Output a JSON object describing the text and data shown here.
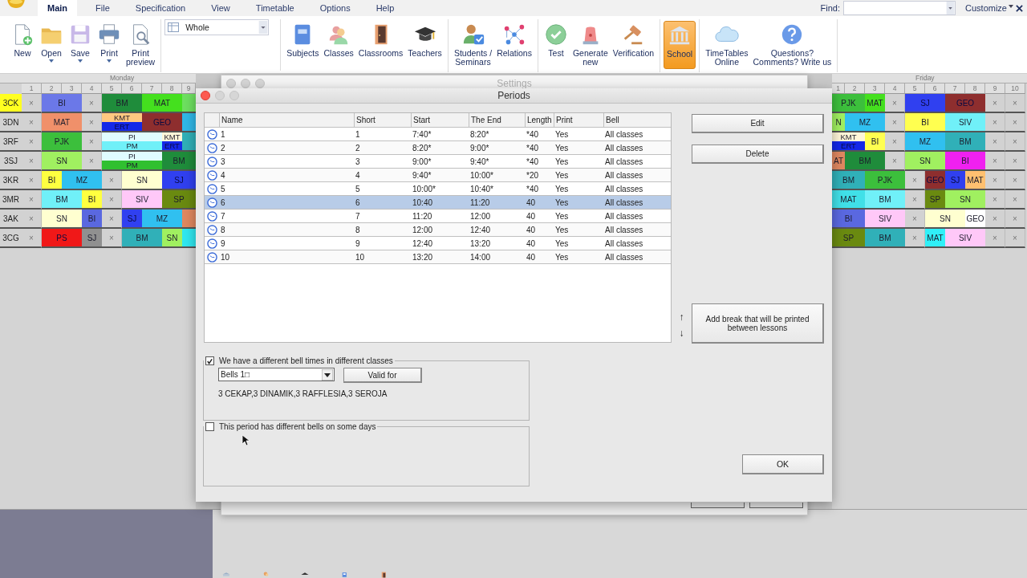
{
  "menu": {
    "tabs": [
      {
        "label": "Main",
        "selected": true
      },
      {
        "label": "File",
        "selected": false
      },
      {
        "label": "Specification",
        "selected": false
      },
      {
        "label": "View",
        "selected": false
      },
      {
        "label": "Timetable",
        "selected": false
      },
      {
        "label": "Options",
        "selected": false
      },
      {
        "label": "Help",
        "selected": false
      }
    ],
    "find_label": "Find:",
    "customize": "Customize"
  },
  "ribbon": {
    "groups": [
      {
        "kind": "buttons",
        "buttons": [
          {
            "label": "New",
            "has_menu": false,
            "selected": false
          },
          {
            "label": "Open",
            "has_menu": true,
            "selected": false
          },
          {
            "label": "Save",
            "has_menu": true,
            "selected": false
          },
          {
            "label": "Print",
            "has_menu": true,
            "selected": false
          },
          {
            "label": "Print\npreview",
            "has_menu": false,
            "selected": false
          }
        ]
      },
      {
        "kind": "dropdown",
        "value": "Whole"
      },
      {
        "kind": "buttons",
        "buttons": [
          {
            "label": "Subjects",
            "has_menu": false,
            "selected": false
          },
          {
            "label": "Classes",
            "has_menu": false,
            "selected": false
          },
          {
            "label": "Classrooms",
            "has_menu": false,
            "selected": false
          },
          {
            "label": "Teachers",
            "has_menu": false,
            "selected": false
          }
        ]
      },
      {
        "kind": "buttons",
        "buttons": [
          {
            "label": "Students /\nSeminars",
            "has_menu": false,
            "selected": false
          },
          {
            "label": "Relations",
            "has_menu": false,
            "selected": false
          }
        ]
      },
      {
        "kind": "buttons",
        "buttons": [
          {
            "label": "Test",
            "has_menu": false,
            "selected": false
          },
          {
            "label": "Generate\nnew",
            "has_menu": false,
            "selected": false
          },
          {
            "label": "Verification",
            "has_menu": false,
            "selected": false
          }
        ]
      },
      {
        "kind": "buttons",
        "buttons": [
          {
            "label": "School",
            "has_menu": false,
            "selected": true
          }
        ]
      },
      {
        "kind": "buttons",
        "buttons": [
          {
            "label": "TimeTables\nOnline",
            "has_menu": false,
            "selected": false
          },
          {
            "label": "Questions?\nComments? Write us",
            "has_menu": false,
            "selected": false
          }
        ]
      }
    ]
  },
  "timetable": {
    "left": {
      "day": "Monday",
      "periods": [
        "1",
        "2",
        "3",
        "4",
        "5",
        "6",
        "7",
        "8",
        "9"
      ],
      "rows": [
        {
          "class": "3CK",
          "selected": true,
          "cells": [
            {
              "kind": "free",
              "text": "×"
            },
            {
              "kind": "lesson",
              "text": "BI",
              "color": "#6b78e8",
              "colspan": 2
            },
            {
              "kind": "free",
              "text": "×"
            },
            {
              "kind": "lesson",
              "text": "BM",
              "color": "#1f8c3b",
              "colspan": 2
            },
            {
              "kind": "lesson",
              "text": "MAT",
              "color": "#44e01e",
              "colspan": 2
            },
            {
              "kind": "cut",
              "color": "#6ee060"
            }
          ]
        },
        {
          "class": "3DN",
          "selected": false,
          "cells": [
            {
              "kind": "free",
              "text": "×"
            },
            {
              "kind": "lesson",
              "text": "MAT",
              "color": "#f0906a",
              "colspan": 2
            },
            {
              "kind": "free",
              "text": "×"
            },
            {
              "kind": "split",
              "colspan": 2,
              "parts": [
                {
                  "text": "KMT",
                  "color": "#ffc880"
                },
                {
                  "text": "ERT",
                  "color": "#1428e8"
                }
              ]
            },
            {
              "kind": "lesson",
              "text": "GEO",
              "color": "#8e2e2e",
              "colspan": 2
            },
            {
              "kind": "cut",
              "color": "#30b8e8"
            }
          ]
        },
        {
          "class": "3RF",
          "selected": false,
          "cells": [
            {
              "kind": "free",
              "text": "×"
            },
            {
              "kind": "lesson",
              "text": "PJK",
              "color": "#3cbf3c",
              "colspan": 2
            },
            {
              "kind": "free",
              "text": "×"
            },
            {
              "kind": "split",
              "colspan": 3,
              "parts": [
                {
                  "text": "PI",
                  "color": "#e0fcff"
                },
                {
                  "text": "PM",
                  "color": "#70f0f8"
                }
              ]
            },
            {
              "kind": "split",
              "parts": [
                {
                  "text": "KMT",
                  "color": "#fff6d8"
                },
                {
                  "text": "ERT",
                  "color": "#1428e8"
                }
              ]
            },
            {
              "kind": "cut",
              "color": "#30b0b8"
            }
          ]
        },
        {
          "class": "3SJ",
          "selected": false,
          "cells": [
            {
              "kind": "free",
              "text": "×"
            },
            {
              "kind": "lesson",
              "text": "SN",
              "color": "#a0f060",
              "colspan": 2
            },
            {
              "kind": "free",
              "text": "×"
            },
            {
              "kind": "split",
              "colspan": 3,
              "parts": [
                {
                  "text": "PI",
                  "color": "#e0fcff"
                },
                {
                  "text": "PM",
                  "color": "#30c030"
                }
              ]
            },
            {
              "kind": "lesson",
              "text": "BM",
              "color": "#1f8c3b",
              "colspan": 2
            }
          ]
        },
        {
          "class": "3KR",
          "selected": false,
          "cells": [
            {
              "kind": "free",
              "text": "×"
            },
            {
              "kind": "lesson",
              "text": "BI",
              "color": "#ffff40"
            },
            {
              "kind": "lesson",
              "text": "MZ",
              "color": "#30c0f0",
              "colspan": 2
            },
            {
              "kind": "free",
              "text": "×"
            },
            {
              "kind": "lesson",
              "text": "SN",
              "color": "#ffffd0",
              "colspan": 2
            },
            {
              "kind": "lesson",
              "text": "SJ",
              "color": "#3040f0",
              "colspan": 2
            }
          ]
        },
        {
          "class": "3MR",
          "selected": false,
          "cells": [
            {
              "kind": "free",
              "text": "×"
            },
            {
              "kind": "lesson",
              "text": "BM",
              "color": "#70f0f8",
              "colspan": 2
            },
            {
              "kind": "lesson",
              "text": "BI",
              "color": "#ffff40"
            },
            {
              "kind": "free",
              "text": "×"
            },
            {
              "kind": "lesson",
              "text": "SIV",
              "color": "#ffc8f8",
              "colspan": 2
            },
            {
              "kind": "lesson",
              "text": "SP",
              "color": "#6a8a10",
              "colspan": 2
            }
          ]
        },
        {
          "class": "3AK",
          "selected": false,
          "cells": [
            {
              "kind": "free",
              "text": "×"
            },
            {
              "kind": "lesson",
              "text": "SN",
              "color": "#ffffd0",
              "colspan": 2
            },
            {
              "kind": "lesson",
              "text": "BI",
              "color": "#5a68e0"
            },
            {
              "kind": "free",
              "text": "×"
            },
            {
              "kind": "lesson",
              "text": "SJ",
              "color": "#3040f0"
            },
            {
              "kind": "lesson",
              "text": "MZ",
              "color": "#30c0f0",
              "colspan": 2
            },
            {
              "kind": "cut",
              "color": "#e08860"
            }
          ]
        },
        {
          "class": "3CG",
          "selected": false,
          "cells": [
            {
              "kind": "free",
              "text": "×"
            },
            {
              "kind": "lesson",
              "text": "PS",
              "color": "#f01818",
              "colspan": 2
            },
            {
              "kind": "lesson",
              "text": "SJ",
              "color": "#909090"
            },
            {
              "kind": "free",
              "text": "×"
            },
            {
              "kind": "lesson",
              "text": "BM",
              "color": "#30b0b8",
              "colspan": 2
            },
            {
              "kind": "lesson",
              "text": "SN",
              "color": "#a0f060"
            },
            {
              "kind": "cut",
              "color": "#30e8f0"
            }
          ]
        }
      ]
    },
    "right": {
      "day": "Friday",
      "periods": [
        "1",
        "2",
        "3",
        "4",
        "5",
        "6",
        "7",
        "8",
        "9",
        "10"
      ],
      "rows": [
        {
          "cells": [
            {
              "kind": "lesson",
              "text": "PJK",
              "color": "#3cbf3c",
              "colspan": 2
            },
            {
              "kind": "lesson",
              "text": "MAT",
              "color": "#44e01e"
            },
            {
              "kind": "free",
              "text": "×"
            },
            {
              "kind": "lesson",
              "text": "SJ",
              "color": "#3040f0",
              "colspan": 2
            },
            {
              "kind": "lesson",
              "text": "GEO",
              "color": "#8e2e2e",
              "colspan": 2
            },
            {
              "kind": "free",
              "text": "×"
            },
            {
              "kind": "free",
              "text": "×"
            }
          ]
        },
        {
          "cells": [
            {
              "kind": "lesson",
              "text": "N",
              "color": "#a0f060"
            },
            {
              "kind": "lesson",
              "text": "MZ",
              "color": "#30c0f0",
              "colspan": 2
            },
            {
              "kind": "free",
              "text": "×"
            },
            {
              "kind": "lesson",
              "text": "BI",
              "color": "#ffff50",
              "colspan": 2
            },
            {
              "kind": "lesson",
              "text": "SIV",
              "color": "#70f0f8",
              "colspan": 2
            },
            {
              "kind": "free",
              "text": "×"
            },
            {
              "kind": "free",
              "text": "×"
            }
          ]
        },
        {
          "cells": [
            {
              "kind": "split",
              "colspan": 2,
              "parts": [
                {
                  "text": "KMT",
                  "color": "#fff6d8"
                },
                {
                  "text": "ERT",
                  "color": "#1428e8"
                }
              ]
            },
            {
              "kind": "lesson",
              "text": "BI",
              "color": "#ffff50"
            },
            {
              "kind": "free",
              "text": "×"
            },
            {
              "kind": "lesson",
              "text": "MZ",
              "color": "#30c0f0",
              "colspan": 2
            },
            {
              "kind": "lesson",
              "text": "BM",
              "color": "#30b0b8",
              "colspan": 2
            },
            {
              "kind": "free",
              "text": "×"
            },
            {
              "kind": "free",
              "text": "×"
            }
          ]
        },
        {
          "cells": [
            {
              "kind": "lesson",
              "text": "AT",
              "color": "#e08860"
            },
            {
              "kind": "lesson",
              "text": "BM",
              "color": "#1f8c3b",
              "colspan": 2
            },
            {
              "kind": "free",
              "text": "×"
            },
            {
              "kind": "lesson",
              "text": "SN",
              "color": "#a0f060",
              "colspan": 2
            },
            {
              "kind": "lesson",
              "text": "BI",
              "color": "#f020f0",
              "colspan": 2
            },
            {
              "kind": "free",
              "text": "×"
            },
            {
              "kind": "free",
              "text": "×"
            }
          ]
        },
        {
          "cells": [
            {
              "kind": "lesson",
              "text": "BM",
              "color": "#30b0b8",
              "colspan": 2
            },
            {
              "kind": "lesson",
              "text": "PJK",
              "color": "#3cbf3c",
              "colspan": 2
            },
            {
              "kind": "free",
              "text": "×"
            },
            {
              "kind": "lesson",
              "text": "GEO",
              "color": "#8e2e2e"
            },
            {
              "kind": "lesson",
              "text": "SJ",
              "color": "#3040f0"
            },
            {
              "kind": "lesson",
              "text": "MAT",
              "color": "#ffc070"
            },
            {
              "kind": "free",
              "text": "×"
            },
            {
              "kind": "free",
              "text": "×"
            }
          ]
        },
        {
          "cells": [
            {
              "kind": "lesson",
              "text": "MAT",
              "color": "#40e0e8",
              "colspan": 2
            },
            {
              "kind": "lesson",
              "text": "BM",
              "color": "#70f0f8",
              "colspan": 2
            },
            {
              "kind": "free",
              "text": "×"
            },
            {
              "kind": "lesson",
              "text": "SP",
              "color": "#6a8a10"
            },
            {
              "kind": "lesson",
              "text": "SN",
              "color": "#a0f060",
              "colspan": 2
            },
            {
              "kind": "free",
              "text": "×"
            },
            {
              "kind": "free",
              "text": "×"
            }
          ]
        },
        {
          "cells": [
            {
              "kind": "lesson",
              "text": "BI",
              "color": "#5a68e0",
              "colspan": 2
            },
            {
              "kind": "lesson",
              "text": "SIV",
              "color": "#ffc8f8",
              "colspan": 2
            },
            {
              "kind": "free",
              "text": "×"
            },
            {
              "kind": "lesson",
              "text": "SN",
              "color": "#ffffd0",
              "colspan": 2
            },
            {
              "kind": "lesson",
              "text": "GEO",
              "color": "#ffffff"
            },
            {
              "kind": "free",
              "text": "×"
            },
            {
              "kind": "free",
              "text": "×"
            }
          ]
        },
        {
          "cells": [
            {
              "kind": "lesson",
              "text": "SP",
              "color": "#6a8a10",
              "colspan": 2
            },
            {
              "kind": "lesson",
              "text": "BM",
              "color": "#30b0b8",
              "colspan": 2
            },
            {
              "kind": "free",
              "text": "×"
            },
            {
              "kind": "lesson",
              "text": "MAT",
              "color": "#30f0f8"
            },
            {
              "kind": "lesson",
              "text": "SIV",
              "color": "#ffc8f8",
              "colspan": 2
            },
            {
              "kind": "free",
              "text": "×"
            },
            {
              "kind": "free",
              "text": "×"
            }
          ]
        }
      ]
    }
  },
  "settings_dialog": {
    "title": "Settings"
  },
  "periods_dialog": {
    "title": "Periods",
    "table": {
      "columns": [
        "Name",
        "Short",
        "Start",
        "The End",
        "Length",
        "Print",
        "Bell"
      ],
      "rows": [
        {
          "selected": false,
          "cells": [
            "1",
            "1",
            "7:40*",
            "8:20*",
            "*40",
            "Yes",
            "All classes"
          ]
        },
        {
          "selected": false,
          "cells": [
            "2",
            "2",
            "8:20*",
            "9:00*",
            "*40",
            "Yes",
            "All classes"
          ]
        },
        {
          "selected": false,
          "cells": [
            "3",
            "3",
            "9:00*",
            "9:40*",
            "*40",
            "Yes",
            "All classes"
          ]
        },
        {
          "selected": false,
          "cells": [
            "4",
            "4",
            "9:40*",
            "10:00*",
            "*20",
            "Yes",
            "All classes"
          ]
        },
        {
          "selected": false,
          "cells": [
            "5",
            "5",
            "10:00*",
            "10:40*",
            "*40",
            "Yes",
            "All classes"
          ]
        },
        {
          "selected": true,
          "cells": [
            "6",
            "6",
            "10:40",
            "11:20",
            "40",
            "Yes",
            "All classes"
          ]
        },
        {
          "selected": false,
          "cells": [
            "7",
            "7",
            "11:20",
            "12:00",
            "40",
            "Yes",
            "All classes"
          ]
        },
        {
          "selected": false,
          "cells": [
            "8",
            "8",
            "12:00",
            "12:40",
            "40",
            "Yes",
            "All classes"
          ]
        },
        {
          "selected": false,
          "cells": [
            "9",
            "9",
            "12:40",
            "13:20",
            "40",
            "Yes",
            "All classes"
          ]
        },
        {
          "selected": false,
          "cells": [
            "10",
            "10",
            "13:20",
            "14:00",
            "40",
            "Yes",
            "All classes"
          ]
        }
      ]
    },
    "buttons": [
      "Edit",
      "Delete"
    ],
    "arrows": [
      "↑",
      "↓"
    ],
    "add_break": "Add break that will be printed between lessons",
    "bells_group": {
      "checked": true,
      "label": "We have a different bell times in different classes",
      "dropdown": "Bells 1□",
      "valid_for": "Valid for",
      "classes": "3 CEKAP,3 DINAMIK,3 RAFFLESIA,3 SEROJA"
    },
    "days_group": {
      "checked": false,
      "label": "This period has different bells on some days"
    },
    "ok": "OK"
  }
}
